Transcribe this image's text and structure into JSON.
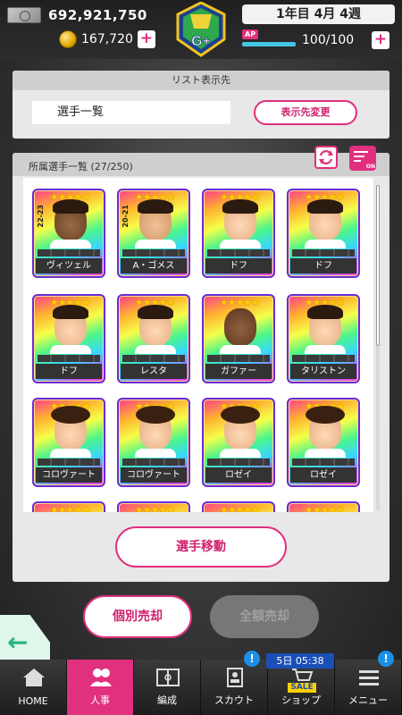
{
  "status": {
    "money": "692,921,750",
    "coins": "167,720",
    "date": "1年目 4月 4週",
    "ap_label": "AP",
    "ap": "100/100",
    "emblem_text": "G+",
    "plus": "+"
  },
  "list_destination": {
    "header": "リスト表示先",
    "current": "選手一覧",
    "change_button": "表示先変更"
  },
  "roster": {
    "title": "所属選手一覧 (27/250)",
    "filter_tag": "ON",
    "move_button": "選手移動",
    "players": [
      {
        "name": "ヴィツェル",
        "season": "22-23",
        "skin": "dark"
      },
      {
        "name": "A・ゴメス",
        "season": "20-21",
        "skin": "tan"
      },
      {
        "name": "ドフ",
        "season": "",
        "skin": "light"
      },
      {
        "name": "ドフ",
        "season": "",
        "skin": "light"
      },
      {
        "name": "ドフ",
        "season": "",
        "skin": "light"
      },
      {
        "name": "レスタ",
        "season": "",
        "skin": "light"
      },
      {
        "name": "ガファー",
        "season": "",
        "skin": "bald"
      },
      {
        "name": "タリストン",
        "season": "",
        "skin": "light"
      },
      {
        "name": "コロヴァート",
        "season": "",
        "skin": "curly"
      },
      {
        "name": "コロヴァート",
        "season": "",
        "skin": "curly"
      },
      {
        "name": "ロゼイ",
        "season": "",
        "skin": "curly"
      },
      {
        "name": "ロゼイ",
        "season": "",
        "skin": "curly"
      }
    ],
    "star_count": 5
  },
  "actions": {
    "sell_individual": "個別売却",
    "sell_all": "全額売却"
  },
  "nav": {
    "items": [
      {
        "label": "HOME",
        "icon": "home-icon"
      },
      {
        "label": "人事",
        "icon": "people-icon"
      },
      {
        "label": "編成",
        "icon": "field-icon"
      },
      {
        "label": "スカウト",
        "icon": "scout-icon"
      },
      {
        "label": "ショップ",
        "icon": "cart-icon"
      },
      {
        "label": "メニュー",
        "icon": "menu-icon"
      }
    ],
    "sale_timer": "5日 05:38",
    "sale_tag": "SALE",
    "badge": "!"
  },
  "colors": {
    "accent": "#e0307e",
    "badge": "#1b8ee8",
    "sale": "#1b4fb8"
  }
}
